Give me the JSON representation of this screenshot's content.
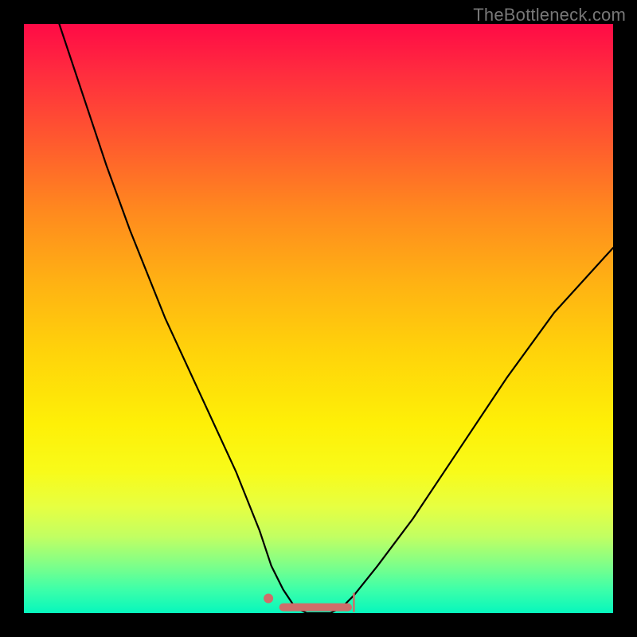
{
  "attribution": "TheBottleneck.com",
  "colors": {
    "frame_background": "#000000",
    "gradient_top": "#ff0a46",
    "gradient_bottom": "#06f7bd",
    "curve": "#000000",
    "marker": "#ce6e6a",
    "attribution_text": "#777777"
  },
  "chart_data": {
    "type": "line",
    "title": "",
    "xlabel": "",
    "ylabel": "",
    "xlim": [
      0,
      100
    ],
    "ylim": [
      0,
      100
    ],
    "description": "Single V-shaped bottleneck curve on a vertical red→green gradient. Y≈100 at x≈6, drops to near 0 at x≈45–55 (flat minimum marked with salmon segment and dot), then rises back to ~62 at x≈100.",
    "series": [
      {
        "name": "bottleneck-curve",
        "x": [
          6,
          10,
          14,
          18,
          24,
          30,
          36,
          40,
          42,
          44,
          46,
          48,
          50,
          52,
          54,
          56,
          60,
          66,
          74,
          82,
          90,
          100
        ],
        "values": [
          100,
          88,
          76,
          65,
          50,
          37,
          24,
          14,
          8,
          4,
          1,
          0,
          0,
          0,
          1,
          3,
          8,
          16,
          28,
          40,
          51,
          62
        ]
      }
    ],
    "markers": {
      "flat_minimum": {
        "x_start": 44,
        "x_end": 55,
        "y": 1
      },
      "dot": {
        "x": 41.5,
        "y": 2.5
      },
      "tick_at_right_of_flat": {
        "x": 56,
        "y_from": 0.3,
        "y_to": 3.3
      }
    },
    "grid": false,
    "legend": false
  }
}
